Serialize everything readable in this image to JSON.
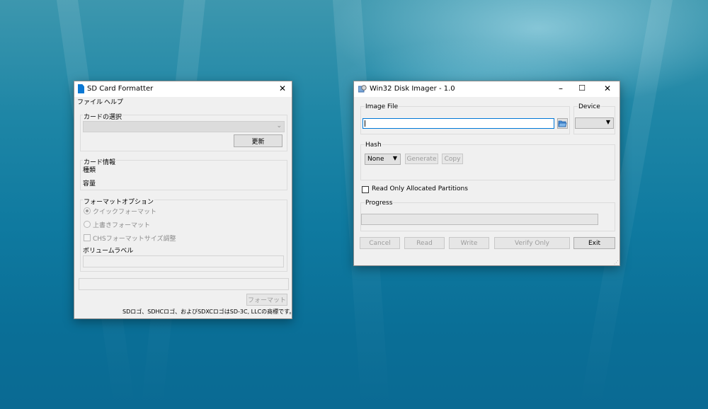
{
  "sd_formatter": {
    "title": "SD Card Formatter",
    "menu": [
      "ファイル",
      "ヘルプ"
    ],
    "card_select_label": "カードの選択",
    "refresh_button": "更新",
    "card_info_label": "カード情報",
    "type_label": "種類",
    "capacity_label": "容量",
    "format_options_label": "フォーマットオプション",
    "quick_format": "クイックフォーマット",
    "overwrite_format": "上書きフォーマット",
    "chs_adjust": "CHSフォーマットサイズ調整",
    "volume_label_label": "ボリュームラベル",
    "volume_label_value": "",
    "format_button": "フォーマット",
    "trademark": "SDロゴ、SDHCロゴ、およびSDXCロゴはSD-3C, LLCの商標です。"
  },
  "disk_imager": {
    "title": "Win32 Disk Imager - 1.0",
    "image_file_label": "Image File",
    "image_file_value": "",
    "device_label": "Device",
    "device_value": "",
    "hash_label": "Hash",
    "hash_value": "None",
    "generate_button": "Generate",
    "copy_button": "Copy",
    "read_only_label": "Read Only Allocated Partitions",
    "read_only_checked": false,
    "progress_label": "Progress",
    "progress": 0,
    "buttons": {
      "cancel": "Cancel",
      "read": "Read",
      "write": "Write",
      "verify": "Verify Only",
      "exit": "Exit"
    }
  },
  "icons": {
    "sd_app": "sd-card-icon",
    "imager_app": "disk-imager-icon",
    "folder": "folder-open-icon",
    "minimize": "minimize-icon",
    "maximize": "maximize-icon",
    "close": "close-icon",
    "dropdown": "chevron-down-icon"
  },
  "colors": {
    "desktop": "#0f7aa0",
    "window_bg": "#f0f0f0",
    "sd_icon": "#0a78d4",
    "input_focus_border": "#0078d7"
  }
}
